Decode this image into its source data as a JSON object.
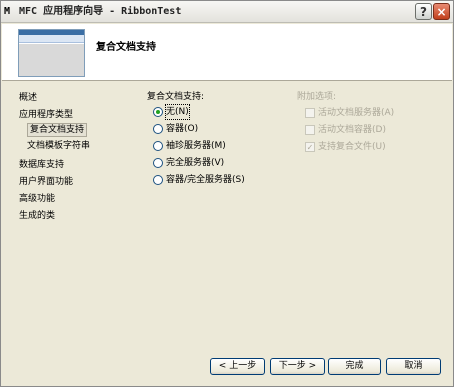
{
  "window": {
    "app_icon": "M",
    "title": "MFC 应用程序向导 - RibbonTest",
    "help_glyph": "?",
    "close_glyph": "×"
  },
  "header": {
    "title": "复合文档支持"
  },
  "nav": {
    "items": [
      {
        "label": "概述"
      },
      {
        "label": "应用程序类型"
      },
      {
        "label": "复合文档支持"
      },
      {
        "label": "文档模板字符串"
      },
      {
        "label": "数据库支持"
      },
      {
        "label": "用户界面功能"
      },
      {
        "label": "高级功能"
      },
      {
        "label": "生成的类"
      }
    ]
  },
  "compound": {
    "label": "复合文档支持:",
    "options": [
      {
        "label": "无(N)",
        "checked": true
      },
      {
        "label": "容器(O)",
        "checked": false
      },
      {
        "label": "袖珍服务器(M)",
        "checked": false
      },
      {
        "label": "完全服务器(V)",
        "checked": false
      },
      {
        "label": "容器/完全服务器(S)",
        "checked": false
      }
    ]
  },
  "additional": {
    "label": "附加选项:",
    "options": [
      {
        "label": "活动文档服务器(A)",
        "checked": false
      },
      {
        "label": "活动文档容器(D)",
        "checked": false
      },
      {
        "label": "支持复合文件(U)",
        "checked": true
      }
    ]
  },
  "buttons": {
    "prev": "< 上一步",
    "next": "下一步 >",
    "finish": "完成",
    "cancel": "取消"
  },
  "icons": {
    "app": "mfc-app-icon",
    "help": "help-icon",
    "close": "close-icon",
    "check": "checkmark-icon"
  }
}
